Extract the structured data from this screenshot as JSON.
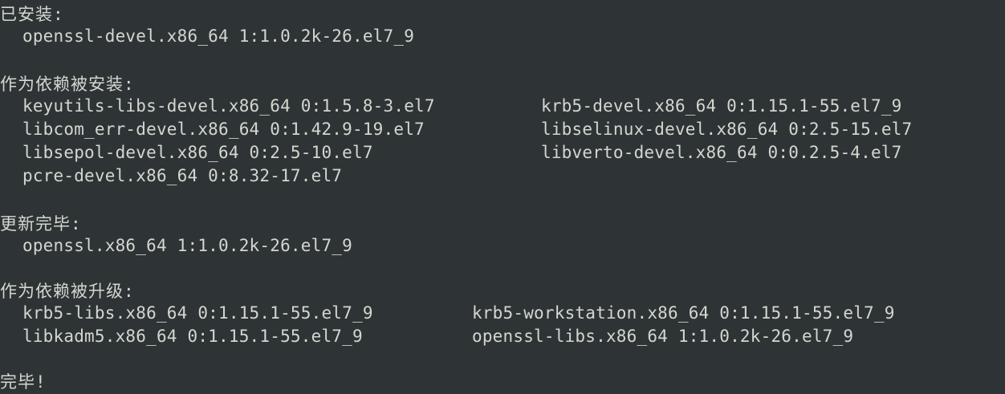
{
  "terminal": {
    "installed": {
      "header": "已安装:",
      "packages": [
        "openssl-devel.x86_64 1:1.0.2k-26.el7_9"
      ]
    },
    "dependencies_installed": {
      "header": "作为依赖被安装:",
      "packages": [
        "keyutils-libs-devel.x86_64 0:1.5.8-3.el7",
        "krb5-devel.x86_64 0:1.15.1-55.el7_9",
        "libcom_err-devel.x86_64 0:1.42.9-19.el7",
        "libselinux-devel.x86_64 0:2.5-15.el7",
        "libsepol-devel.x86_64 0:2.5-10.el7",
        "libverto-devel.x86_64 0:0.2.5-4.el7",
        "pcre-devel.x86_64 0:8.32-17.el7"
      ]
    },
    "updated": {
      "header": "更新完毕:",
      "packages": [
        "openssl.x86_64 1:1.0.2k-26.el7_9"
      ]
    },
    "dependencies_upgraded": {
      "header": "作为依赖被升级:",
      "packages": [
        "krb5-libs.x86_64 0:1.15.1-55.el7_9",
        "krb5-workstation.x86_64 0:1.15.1-55.el7_9",
        "libkadm5.x86_64 0:1.15.1-55.el7_9",
        "openssl-libs.x86_64 1:1.0.2k-26.el7_9"
      ]
    },
    "complete": "完毕!"
  }
}
